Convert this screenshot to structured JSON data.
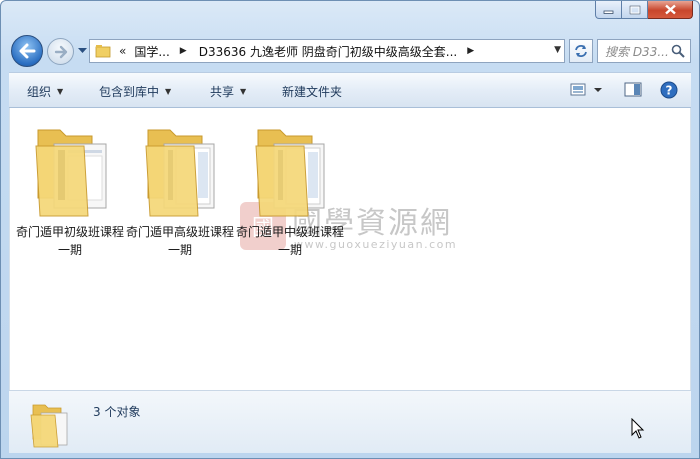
{
  "window": {
    "caption_buttons": [
      "minimize",
      "maximize",
      "close"
    ]
  },
  "address_bar": {
    "overflow": "«",
    "crumbs": [
      "国学...",
      "D33636 九逸老师 阴盘奇门初级中级高级全套..."
    ]
  },
  "search": {
    "placeholder": "搜索 D33..."
  },
  "toolbar": {
    "organize": "组织",
    "include_in_library": "包含到库中",
    "share": "共享",
    "new_folder": "新建文件夹"
  },
  "items": [
    {
      "name": "奇门遁甲初级班课程一期"
    },
    {
      "name": "奇门遁甲高级班课程一期"
    },
    {
      "name": "奇门遁甲中级班课程一期"
    }
  ],
  "watermark": {
    "title": "國學資源網",
    "url": "www.guoxueziyuan.com",
    "logo": "國"
  },
  "details": {
    "count": "3 个对象"
  },
  "colors": {
    "accent": "#1e395b",
    "close": "#c8462c",
    "folder": "#f3d36e"
  }
}
